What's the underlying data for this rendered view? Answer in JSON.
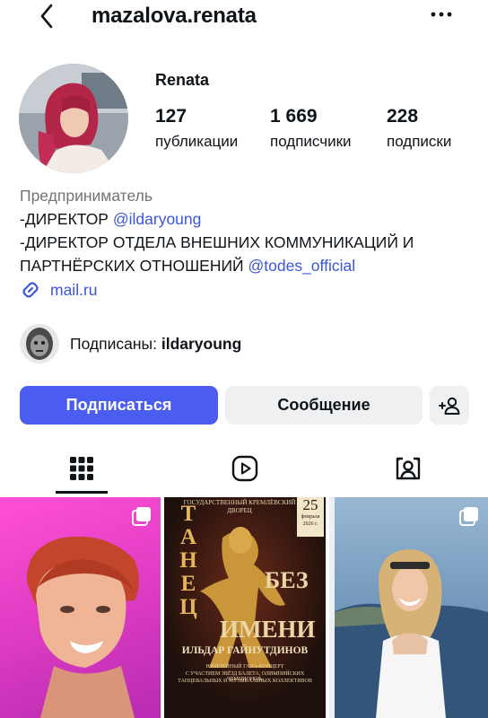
{
  "header": {
    "username": "mazalova.renata",
    "back_icon": "chevron-left-icon",
    "more_icon": "more-horizontal-icon"
  },
  "profile": {
    "display_name": "Renata",
    "stats": [
      {
        "value": "127",
        "label": "публикации"
      },
      {
        "value": "1 669",
        "label": "подписчики"
      },
      {
        "value": "228",
        "label": "подписки"
      }
    ]
  },
  "bio": {
    "category": "Предприниматель",
    "line1_prefix": "-ДИРЕКТОР ",
    "line1_mention": "@ildaryoung",
    "line2_prefix": "-ДИРЕКТОР ОТДЕЛА ВНЕШНИХ КОММУНИКАЦИЙ И ПАРТНЁРСКИХ ОТНОШЕНИЙ ",
    "line2_mention": "@todes_official",
    "link": "mail.ru"
  },
  "followed_by": {
    "prefix": "Подписаны: ",
    "username": "ildaryoung"
  },
  "actions": {
    "follow_label": "Подписаться",
    "message_label": "Сообщение",
    "add_icon": "add-person-icon"
  },
  "tabs": [
    {
      "name": "posts",
      "icon": "grid-icon",
      "active": true
    },
    {
      "name": "reels",
      "icon": "reels-icon",
      "active": false
    },
    {
      "name": "tagged",
      "icon": "tagged-person-icon",
      "active": false
    }
  ],
  "posts": [
    {
      "kind": "photo",
      "multi": true
    },
    {
      "kind": "poster",
      "multi": false,
      "venue": "ГОСУДАРСТВЕННЫЙ КРЕМЛЁВСКИЙ ДВОРЕЦ",
      "date_day": "25",
      "date_month": "февраля",
      "date_year": "2026 г.",
      "title_word1": "ТАНЕЦ",
      "title_word2": "БЕЗ",
      "title_word3": "ИМЕНИ",
      "author": "ИЛЬДАР ГАЙНУТДИНОВ",
      "subtitle": "ЮБИЛЕЙНЫЙ ГАЛА-КОНЦЕРТ",
      "subtitle2": "С УЧАСТИЕМ ЗВЁЗД БАЛЕТА, ОЛИМПИЙСКИХ ЧЕМПИОНОВ,",
      "subtitle3": "ТАНЦЕВАЛЬНЫХ И МУЗЫКАЛЬНЫХ КОЛЛЕКТИВОВ"
    },
    {
      "kind": "photo",
      "multi": true
    }
  ],
  "colors": {
    "accent": "#4a5df0",
    "link": "#3b55d9",
    "secondary_button": "#eff0f2",
    "muted_text": "#737373"
  }
}
